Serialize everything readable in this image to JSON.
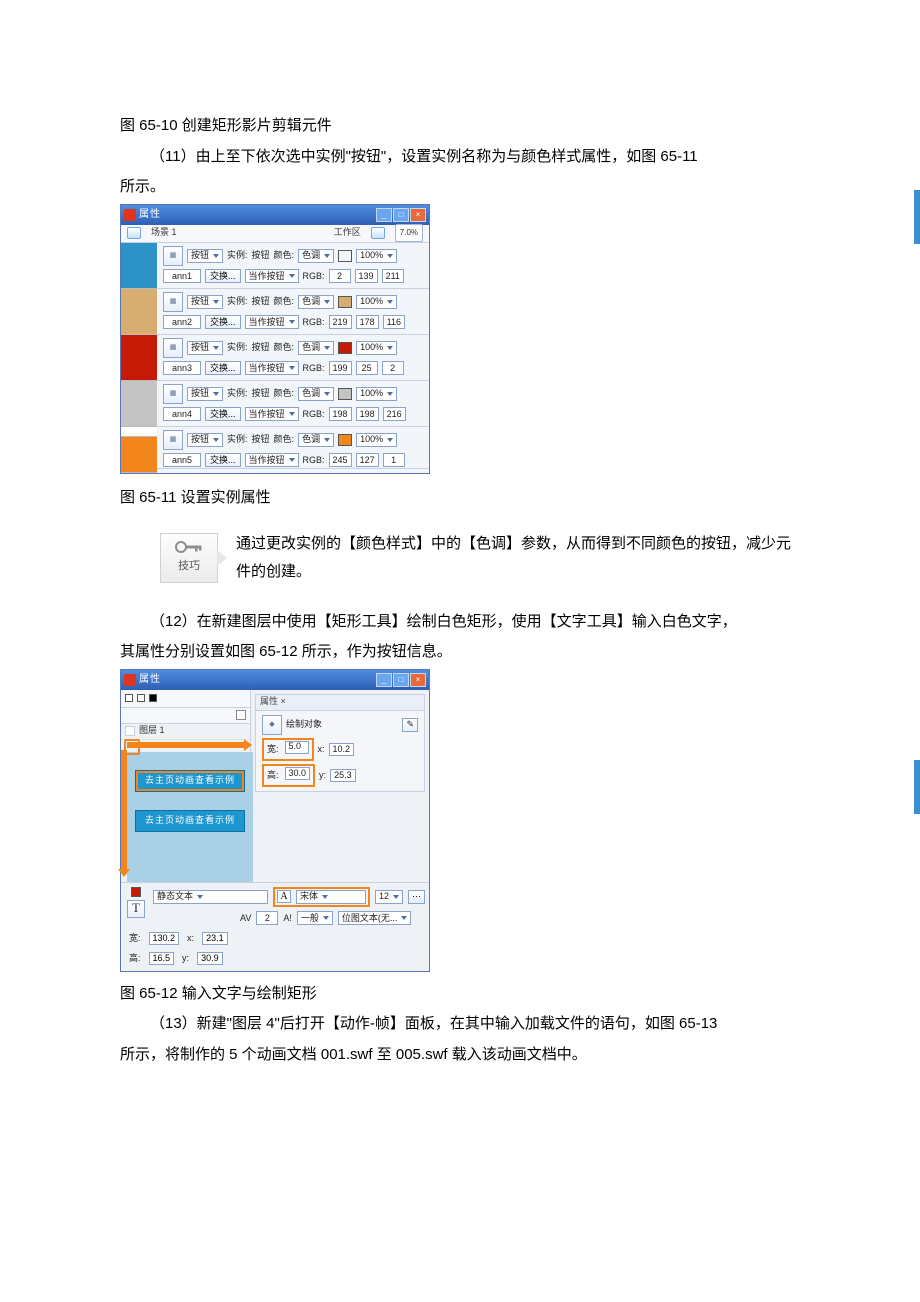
{
  "captions": {
    "fig10": "图 65-10  创建矩形影片剪辑元件",
    "fig11": "图 65-11  设置实例属性",
    "fig12": "图 65-12  输入文字与绘制矩形"
  },
  "paras": {
    "p11": "（11）由上至下依次选中实例\"按钮\"，设置实例名称为与颜色样式属性，如图  65-11",
    "p11b": "所示。",
    "tip": "通过更改实例的【颜色样式】中的【色调】参数，从而得到不同颜色的按钮，减少元件的创建。",
    "p12": "（12）在新建图层中使用【矩形工具】绘制白色矩形，使用【文字工具】输入白色文字，",
    "p12b": "其属性分别设置如图 65-12 所示，作为按钮信息。",
    "p13": "（13）新建\"图层 4\"后打开【动作-帧】面板，在其中输入加载文件的语句，如图 65-13",
    "p13b": "所示，将制作的 5 个动画文档 001.swf 至 005.swf 载入该动画文档中。"
  },
  "tip_label": "技巧",
  "fig11_win": {
    "title": "属性",
    "scene": "场景 1",
    "work_area": "工作区",
    "zoom": "7.0%",
    "rows": [
      {
        "type": "按钮",
        "instance_label": "实例:",
        "instance": "按钮",
        "color_label": "颜色:",
        "color_mode": "色调",
        "chip": "#2d92c7",
        "pct": "100%",
        "name": "ann1",
        "swap": "交换...",
        "track": "当作按钮",
        "rgb_label": "RGB:",
        "r": "2",
        "g": "139",
        "b": "211"
      },
      {
        "type": "按钮",
        "instance_label": "实例:",
        "instance": "按钮",
        "color_label": "颜色:",
        "color_mode": "色调",
        "chip": "#d6ae72",
        "pct": "100%",
        "name": "ann2",
        "swap": "交换...",
        "track": "当作按钮",
        "rgb_label": "RGB:",
        "r": "219",
        "g": "178",
        "b": "116"
      },
      {
        "type": "按钮",
        "instance_label": "实例:",
        "instance": "按钮",
        "color_label": "颜色:",
        "color_mode": "色调",
        "chip": "#c51a05",
        "pct": "100%",
        "name": "ann3",
        "swap": "交换...",
        "track": "当作按钮",
        "rgb_label": "RGB:",
        "r": "199",
        "g": "25",
        "b": "2"
      },
      {
        "type": "按钮",
        "instance_label": "实例:",
        "instance": "按钮",
        "color_label": "颜色:",
        "color_mode": "色调",
        "chip": "#c4c4c4",
        "pct": "100%",
        "name": "ann4",
        "swap": "交换...",
        "track": "当作按钮",
        "rgb_label": "RGB:",
        "r": "198",
        "g": "198",
        "b": "216"
      },
      {
        "type": "按钮",
        "instance_label": "实例:",
        "instance": "按钮",
        "color_label": "颜色:",
        "color_mode": "色调",
        "chip": "#f2851b",
        "pct": "100%",
        "name": "ann5",
        "swap": "交换...",
        "track": "当作按钮",
        "rgb_label": "RGB:",
        "r": "245",
        "g": "127",
        "b": "1"
      }
    ]
  },
  "fig12_win": {
    "title": "属性",
    "panel_tab": "属性 ×",
    "shape_label": "绘制对象",
    "layer": "图层 1",
    "w_label": "宽:",
    "w": "5.0",
    "h_label": "高:",
    "h": "30.0",
    "x_label": "x:",
    "x": "10.2",
    "y_label": "y:",
    "y": "25.3",
    "btn_text1": "去主页动画查看示例",
    "btn_text2": "去主页动画查看示例",
    "type_kind": "静态文本",
    "font_label": "A",
    "font": "宋体",
    "size": "12",
    "av_label": "AV",
    "av": "2",
    "ai_label": "A!",
    "ai": "一般",
    "embed": "位图文本(无...",
    "w2_label": "宽:",
    "w2": "130.2",
    "x2_label": "x:",
    "x2": "23.1",
    "h2_label": "高:",
    "h2": "16.5",
    "y2_label": "y:",
    "y2": "30.9"
  }
}
